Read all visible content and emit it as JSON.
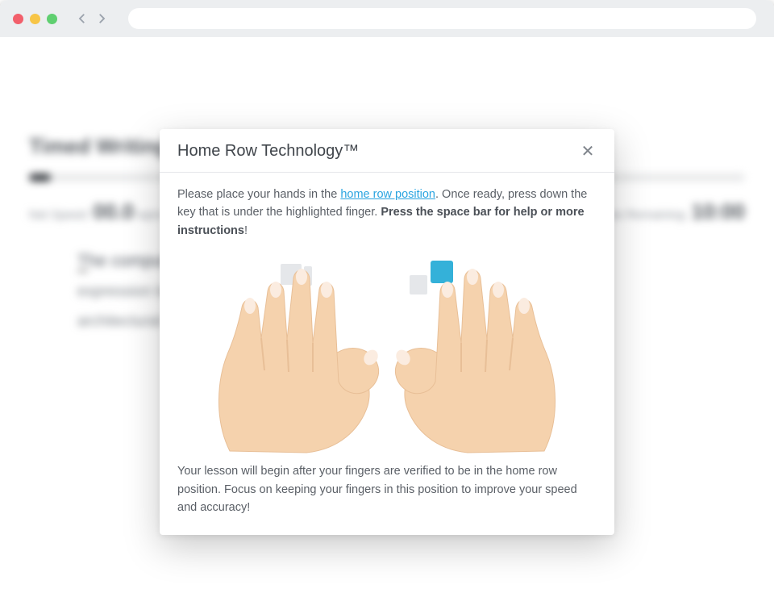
{
  "background": {
    "page_title": "Timed Writing",
    "net_speed_label": "Net Speed:",
    "net_speed_value": "00.0",
    "net_speed_unit": "wpm",
    "time_remaining_label": "Time Remaining:",
    "time_remaining_value": "10:00",
    "passage_line1_em": "T",
    "passage_line1_rest": "he computer is a tool, a mechanism to give physical",
    "passage_line2": "expression to intellectual or",
    "passage_line3": "architectural material"
  },
  "modal": {
    "title": "Home Row Technology™",
    "close_glyph": "✕",
    "instruction_pre": "Please place your hands in the ",
    "instruction_link": "home row position",
    "instruction_mid": ". Once ready, press down the key that is under the highlighted finger. ",
    "instruction_bold": "Press the space bar for help or more instructions",
    "instruction_post": "!",
    "footer_text": "Your lesson will begin after your fingers are verified to be in the home row position. Focus on keeping your fingers in this position to improve your speed and accuracy!",
    "highlighted_key_color": "#34b1d9",
    "inactive_key_color": "#e5e7ea",
    "skin_color": "#f5d2ad",
    "skin_shadow": "#e8bf97",
    "nail_color": "#fbece0"
  }
}
